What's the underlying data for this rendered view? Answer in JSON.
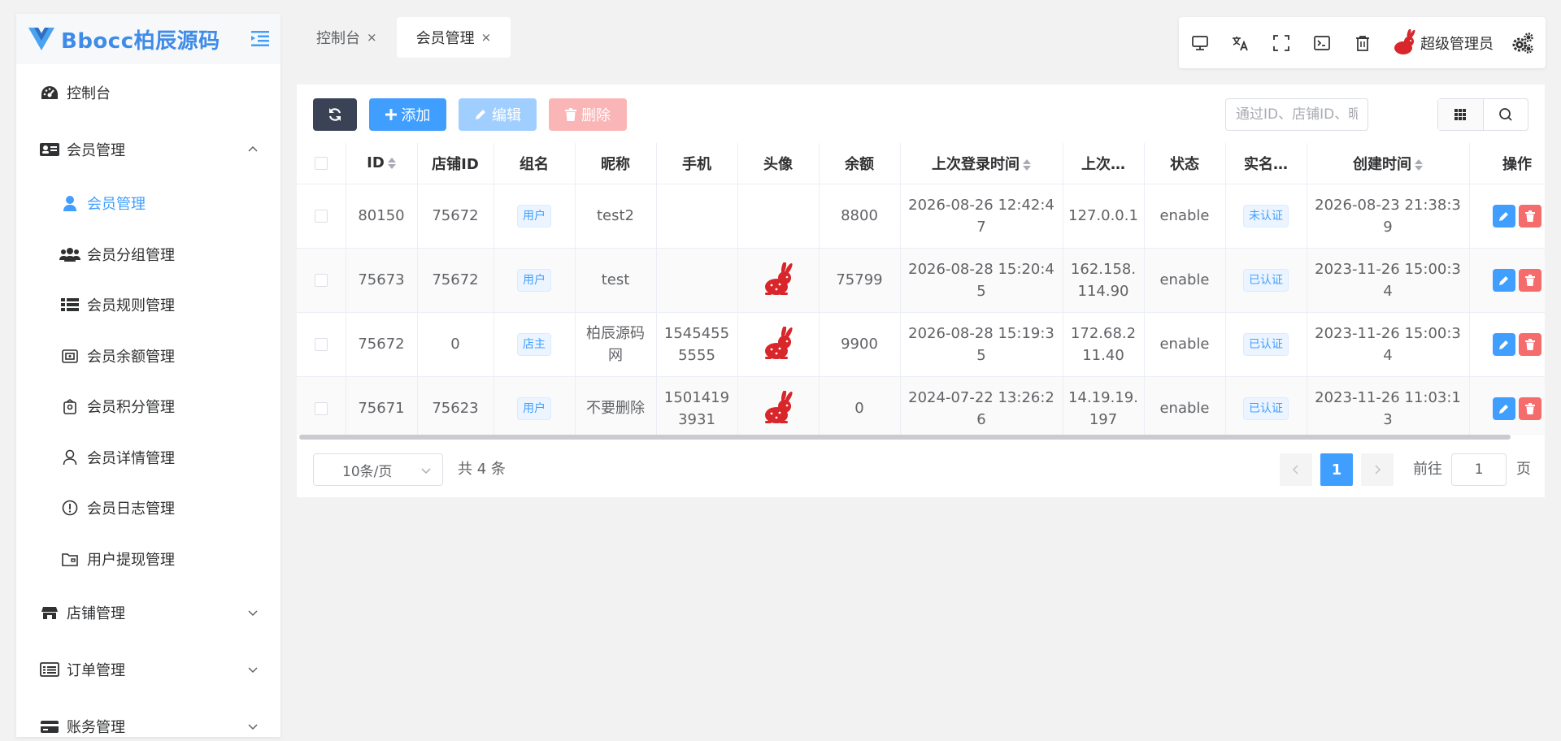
{
  "app": {
    "logo_text": "Bbocc柏辰源码"
  },
  "sidebar": {
    "items": [
      {
        "label": "控制台",
        "icon": "dashboard-icon"
      },
      {
        "label": "会员管理",
        "icon": "id-card-icon",
        "expanded": true
      },
      {
        "label": "店铺管理",
        "icon": "store-icon"
      },
      {
        "label": "订单管理",
        "icon": "list-icon"
      },
      {
        "label": "账务管理",
        "icon": "credit-card-icon"
      }
    ],
    "subitems": [
      {
        "label": "会员管理",
        "icon": "user-icon",
        "active": true
      },
      {
        "label": "会员分组管理",
        "icon": "users-icon"
      },
      {
        "label": "会员规则管理",
        "icon": "list-icon"
      },
      {
        "label": "会员余额管理",
        "icon": "wallet-icon"
      },
      {
        "label": "会员积分管理",
        "icon": "bag-icon"
      },
      {
        "label": "会员详情管理",
        "icon": "person-icon"
      },
      {
        "label": "会员日志管理",
        "icon": "warning-circle-icon"
      },
      {
        "label": "用户提现管理",
        "icon": "folder-icon"
      }
    ]
  },
  "tabs": [
    {
      "label": "控制台",
      "close": "×"
    },
    {
      "label": "会员管理",
      "close": "×",
      "active": true
    }
  ],
  "topbar": {
    "user_name": "超级管理员"
  },
  "toolbar": {
    "add_label": "添加",
    "edit_label": "编辑",
    "delete_label": "删除",
    "search_placeholder": "通过ID、店铺ID、昵称、手机"
  },
  "table": {
    "headers": [
      "ID",
      "店铺ID",
      "组名",
      "昵称",
      "手机",
      "头像",
      "余额",
      "上次登录时间",
      "上次…",
      "状态",
      "实名…",
      "创建时间",
      "操作"
    ],
    "rows": [
      {
        "id": "80150",
        "shop_id": "75672",
        "group": "用户",
        "nickname": "test2",
        "phone": "",
        "avatar": false,
        "balance": "8800",
        "last_login": "2026-08-26 12:42:47",
        "last_ip": "127.0.0.1",
        "status": "enable",
        "verified": "未认证",
        "created": "2026-08-23 21:38:39"
      },
      {
        "id": "75673",
        "shop_id": "75672",
        "group": "用户",
        "nickname": "test",
        "phone": "",
        "avatar": true,
        "balance": "75799",
        "last_login": "2026-08-28 15:20:45",
        "last_ip": "162.158.114.90",
        "status": "enable",
        "verified": "已认证",
        "created": "2023-11-26 15:00:34"
      },
      {
        "id": "75672",
        "shop_id": "0",
        "group": "店主",
        "nickname": "柏辰源码网",
        "phone": "15454555555",
        "avatar": true,
        "balance": "9900",
        "last_login": "2026-08-28 15:19:35",
        "last_ip": "172.68.211.40",
        "status": "enable",
        "verified": "已认证",
        "created": "2023-11-26 15:00:34"
      },
      {
        "id": "75671",
        "shop_id": "75623",
        "group": "用户",
        "nickname": "不要删除",
        "phone": "15014193931",
        "avatar": true,
        "balance": "0",
        "last_login": "2024-07-22 13:26:26",
        "last_ip": "14.19.19.197",
        "status": "enable",
        "verified": "已认证",
        "created": "2023-11-26 11:03:13"
      }
    ]
  },
  "pagination": {
    "page_size": "10条/页",
    "total": "共 4 条",
    "current": "1",
    "goto_label": "前往",
    "goto_value": "1",
    "page_suffix": "页"
  },
  "colors": {
    "primary": "#409eff",
    "danger": "#f56c6c",
    "dark": "#3a4356"
  }
}
